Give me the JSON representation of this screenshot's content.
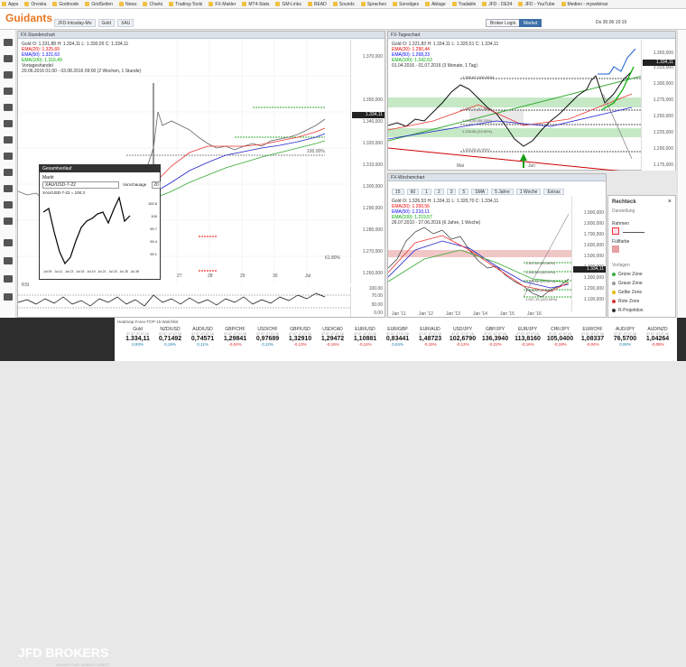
{
  "bookmarks": [
    "Apps",
    "Onvista",
    "Godmode",
    "GridSeiten",
    "News",
    "Charts",
    "Trading-Tools",
    "FX-Makler",
    "MT4-Stats",
    "GM-Links",
    "READ",
    "Sounds",
    "Sprachen",
    "Sonstiges",
    "Ablage",
    "Tradable",
    "JFD - DE34",
    "JFD - YouTube",
    "Medien - mywebinar"
  ],
  "app": {
    "logo": "Guidants",
    "tabs": [
      "JFD-Intraday-Mo",
      "Gold",
      "XAU"
    ],
    "btn_login": "Broker Login",
    "btn_market": "Market",
    "clock": "Do 30.06 10:19"
  },
  "chart1": {
    "title": "FX-Stundenchart",
    "info": [
      "Gold  O: 1.331,88  H: 1.334,11  L: 1.330,05  C: 1.334,11",
      "EMA(20): 1.325,69",
      "EMA(50): 1.321,63",
      "EMA(100): 1.316,49",
      "Vortageshandel",
      "20.06.2016 01:00 - 03.08.2016 09:00 (2 Wochen, 1 Stunde)"
    ],
    "prices": [
      "1.370,000",
      "1.350,000",
      "1.340,000",
      "1.320,000",
      "1.310,000",
      "1.300,000",
      "1.290,000",
      "1.280,000",
      "1.270,000",
      "1.260,000",
      "1.250,000",
      "1.240,000"
    ],
    "last": "1.334,11",
    "fib1": "100.00%",
    "fib2": "61.80%",
    "xlabels": [
      "27",
      "28",
      "29",
      "30",
      "Jul"
    ],
    "rsi_label": "RSI",
    "rsi_levels": [
      "100.00",
      "70.00",
      "30.00",
      "0.00"
    ]
  },
  "chart2": {
    "title": "FX-Tageschart",
    "info": [
      "Gold  O: 1.321,83  H: 1.334,11  L: 1.320,51  C: 1.334,11",
      "EMA(20): 1.290,44",
      "EMA(50): 1.268,23",
      "EMA(100): 1.242,63",
      "01.04.2016 - 01.07.2016 (3 Monate, 1 Tag)"
    ],
    "prices": [
      "1.350,000",
      "1.325,000",
      "1.300,000",
      "1.275,000",
      "1.250,000",
      "1.225,000",
      "1.200,000",
      "1.175,000"
    ],
    "last": "1.334,11",
    "fibs": [
      "1.305,62 (100.00%)",
      "1.283,29 (61.80%)",
      "1.249,35 (38.20%)",
      "1.228,58 (23.60%)",
      "1.203,55 (0.00%)"
    ],
    "xlabels": [
      "Mai",
      "Jun"
    ]
  },
  "chart3": {
    "title": "FX-Wochenchart",
    "toolbar": [
      "15",
      "60",
      "1",
      "2",
      "3",
      "5",
      "SMA",
      "5 Jahre",
      "1 Woche",
      "Extras"
    ],
    "info": [
      "Gold  O: 1.326,53  H: 1.334,11  L: 1.320,70  C: 1.334,11",
      "EMA(20): 1.250,56",
      "EMA(50): 1.210,11",
      "EMA(100): 1.219,57",
      "26.07.2010 - 27.06.2016 (6 Jahre, 1 Woche)"
    ],
    "prices": [
      "1.900,000",
      "1.800,000",
      "1.700,000",
      "1.600,000",
      "1.500,000",
      "1.400,000",
      "1.300,000",
      "1.200,000",
      "1.100,000"
    ],
    "last": "1.334,11",
    "fibs": [
      "1.307,60 (61.80%)",
      "1.262,60 (38.20%)",
      "1.205,40 (23.60%)",
      "1.108,65 (0.00%)",
      "1.047,33 (100.00%)"
    ],
    "xlabels": [
      "Jan '11",
      "Jan '12",
      "Jan '13",
      "Jan '14",
      "Jan '15",
      "Jan '16"
    ]
  },
  "popup": {
    "title": "Gesamtverlauf",
    "label": "Markt",
    "symbol": "XAU/USD-7-22",
    "comparison": "Vorschauage",
    "comp_value": "20",
    "legend": "XAU/USD-7-22 = 100.3",
    "yvals": [
      "100.5",
      "100",
      "99.7",
      "99.4",
      "99.1"
    ],
    "xlabels": [
      "Jul 09",
      "Jul 11",
      "Jul 13",
      "Jul 15",
      "Jul 19",
      "Jul 21",
      "Jul 23",
      "Jul 25",
      "Jul 28"
    ]
  },
  "rechteck": {
    "title": "Rechteck",
    "s1": "Darstellung",
    "s2": "Rahmen",
    "s3": "Füllfarbe",
    "s4": "Vorlagen",
    "items": [
      "Grüne Zone",
      "Graue Zone",
      "Gelbe Zone",
      "Rote Zone",
      "R-Projektion"
    ],
    "colors": [
      "#3cb043",
      "#999999",
      "#e6b800",
      "#dd3333",
      "#333333"
    ]
  },
  "footer": {
    "brand": "JFD BROKERS",
    "tag": "ALWAYS FAIR. ALWAYS DIRECT",
    "ticker_title": "Heatmap  Forex-TOP-15  Watchlist"
  },
  "ticker": [
    {
      "n": "Gold",
      "t": "07.07.-07.07.16",
      "p": "1.334,11",
      "c": "0,93%",
      "neg": false
    },
    {
      "n": "NZD/USD",
      "t": "07.07.-07.07.16",
      "p": "0,71492",
      "c": "0,19%",
      "neg": false
    },
    {
      "n": "AUD/USD",
      "t": "07.07.-07.07.16",
      "p": "0,74571",
      "c": "0,11%",
      "neg": false
    },
    {
      "n": "GBP/CHF",
      "t": "07.07.-07.07.16",
      "p": "1,29841",
      "c": "-0,04%",
      "neg": true
    },
    {
      "n": "USD/CHF",
      "t": "07.07.-07.07.16",
      "p": "0,97689",
      "c": "0,12%",
      "neg": false
    },
    {
      "n": "GBP/USD",
      "t": "07.07.-07.07.16",
      "p": "1,32910",
      "c": "-0,13%",
      "neg": true
    },
    {
      "n": "USD/CAD",
      "t": "07.07.-07.07.16",
      "p": "1,29472",
      "c": "-0,16%",
      "neg": true
    },
    {
      "n": "EUR/USD",
      "t": "07.07.-07.07.16",
      "p": "1,10881",
      "c": "-0,11%",
      "neg": true
    },
    {
      "n": "EUR/GBP",
      "t": "07.07.-07.07.16",
      "p": "0,83441",
      "c": "0,04%",
      "neg": false
    },
    {
      "n": "EUR/AUD",
      "t": "07.07.-07.07.16",
      "p": "1,48723",
      "c": "-0,15%",
      "neg": true
    },
    {
      "n": "USD/JPY",
      "t": "07.07.-07.07.16",
      "p": "102,6790",
      "c": "-0,12%",
      "neg": true
    },
    {
      "n": "GBP/JPY",
      "t": "07.07.-07.07.16",
      "p": "136,3940",
      "c": "-0,22%",
      "neg": true
    },
    {
      "n": "EUR/JPY",
      "t": "07.07.-07.07.16",
      "p": "113,8160",
      "c": "-0,16%",
      "neg": true
    },
    {
      "n": "CHF/JPY",
      "t": "07.07.-07.07.16",
      "p": "105,0400",
      "c": "-0,18%",
      "neg": true
    },
    {
      "n": "EUR/CHF",
      "t": "07.07.-07.07.16",
      "p": "1,08337",
      "c": "-0,04%",
      "neg": true
    },
    {
      "n": "AUD/JPY",
      "t": "07.07.-07.07.16",
      "p": "76,5700",
      "c": "0,06%",
      "neg": false
    },
    {
      "n": "AUD/NZD",
      "t": "07.07.-07.07.16",
      "p": "1,04264",
      "c": "-0,08%",
      "neg": true
    }
  ]
}
